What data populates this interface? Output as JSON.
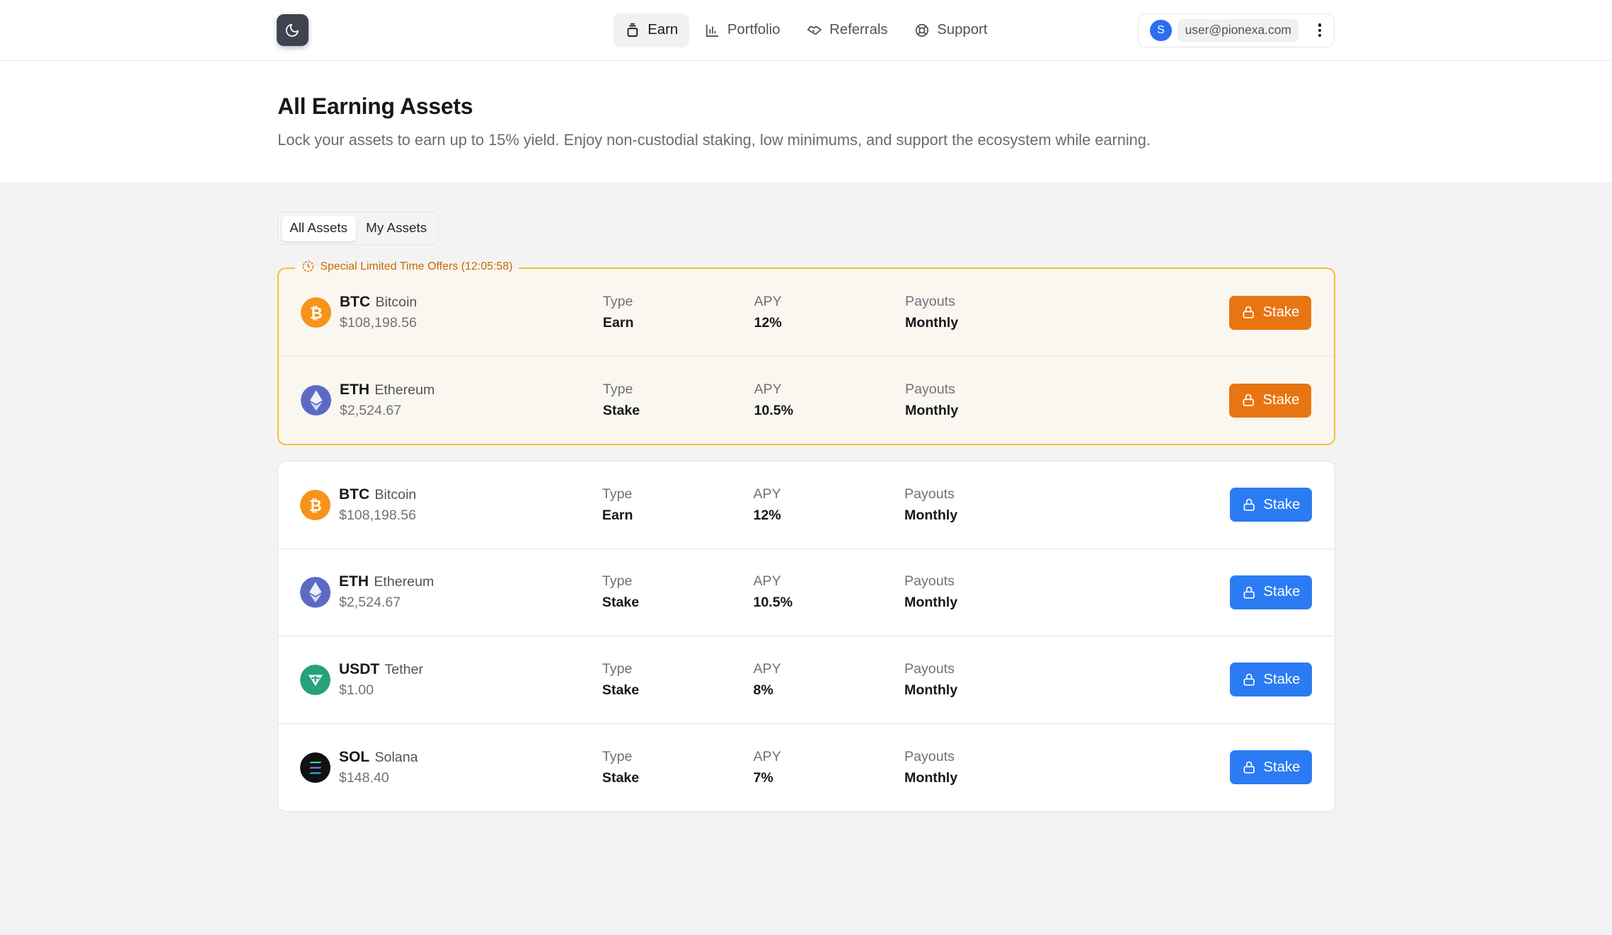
{
  "nav": {
    "items": [
      {
        "label": "Earn",
        "icon": "stack-icon",
        "active": true
      },
      {
        "label": "Portfolio",
        "icon": "bar-chart-icon",
        "active": false
      },
      {
        "label": "Referrals",
        "icon": "handshake-icon",
        "active": false
      },
      {
        "label": "Support",
        "icon": "lifebuoy-icon",
        "active": false
      }
    ]
  },
  "user": {
    "initial": "S",
    "email": "user@pionexa.com"
  },
  "hero": {
    "title": "All Earning Assets",
    "subtitle": "Lock your assets to earn up to 15% yield. Enjoy non-custodial staking, low minimums, and support the ecosystem while earning."
  },
  "tabs": [
    {
      "label": "All Assets",
      "active": true
    },
    {
      "label": "My Assets",
      "active": false
    }
  ],
  "special": {
    "label": "Special Limited Time Offers (12:05:58)",
    "rows": [
      {
        "symbol": "BTC",
        "name": "Bitcoin",
        "price": "$108,198.56",
        "type": "Earn",
        "apy": "12%",
        "payouts": "Monthly",
        "button": "Stake"
      },
      {
        "symbol": "ETH",
        "name": "Ethereum",
        "price": "$2,524.67",
        "type": "Stake",
        "apy": "10.5%",
        "payouts": "Monthly",
        "button": "Stake"
      }
    ]
  },
  "labels": {
    "type": "Type",
    "apy": "APY",
    "payouts": "Payouts"
  },
  "assets": [
    {
      "symbol": "BTC",
      "name": "Bitcoin",
      "price": "$108,198.56",
      "type": "Earn",
      "apy": "12%",
      "payouts": "Monthly",
      "button": "Stake"
    },
    {
      "symbol": "ETH",
      "name": "Ethereum",
      "price": "$2,524.67",
      "type": "Stake",
      "apy": "10.5%",
      "payouts": "Monthly",
      "button": "Stake"
    },
    {
      "symbol": "USDT",
      "name": "Tether",
      "price": "$1.00",
      "type": "Stake",
      "apy": "8%",
      "payouts": "Monthly",
      "button": "Stake"
    },
    {
      "symbol": "SOL",
      "name": "Solana",
      "price": "$148.40",
      "type": "Stake",
      "apy": "7%",
      "payouts": "Monthly",
      "button": "Stake"
    }
  ],
  "colors": {
    "special_button": "#e87511",
    "stake_button": "#2b7bf3",
    "special_border": "#f2c230",
    "avatar": "#2b6ff0"
  }
}
